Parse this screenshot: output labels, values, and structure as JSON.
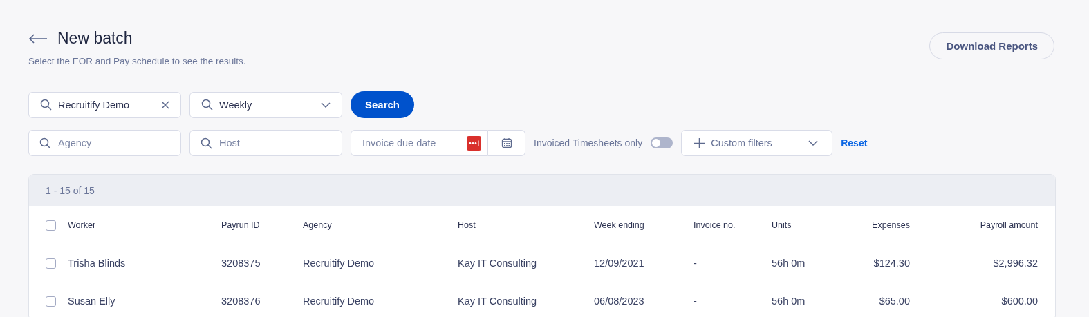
{
  "header": {
    "title": "New batch",
    "subtitle": "Select the EOR and Pay schedule to see the results.",
    "download_button": "Download Reports"
  },
  "filters": {
    "eor": {
      "value": "Recruitify Demo"
    },
    "schedule": {
      "value": "Weekly"
    },
    "search_button": "Search",
    "agency": {
      "placeholder": "Agency"
    },
    "host": {
      "placeholder": "Host"
    },
    "invoice_due_date": {
      "placeholder": "Invoice due date"
    },
    "invoiced_only": {
      "label": "Invoiced Timesheets only",
      "on": false
    },
    "custom_filters": "Custom filters",
    "reset": "Reset"
  },
  "table": {
    "summary": "1 - 15 of 15",
    "select_all": {
      "checked": false
    },
    "columns": [
      "Worker",
      "Payrun ID",
      "Agency",
      "Host",
      "Week ending",
      "Invoice no.",
      "Units",
      "Expenses",
      "Payroll amount"
    ],
    "rows": [
      {
        "checked": false,
        "cells": [
          "Trisha Blinds",
          "3208375",
          "Recruitify Demo",
          "Kay IT Consulting",
          "12/09/2021",
          "-",
          "56h 0m",
          "$124.30",
          "$2,996.32"
        ]
      },
      {
        "checked": false,
        "cells": [
          "Susan Elly",
          "3208376",
          "Recruitify Demo",
          "Kay IT Consulting",
          "06/08/2023",
          "-",
          "56h 0m",
          "$65.00",
          "$600.00"
        ]
      }
    ]
  }
}
